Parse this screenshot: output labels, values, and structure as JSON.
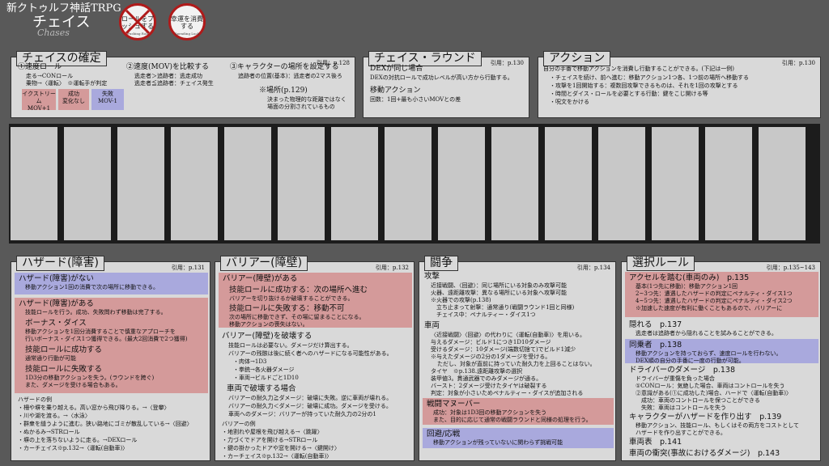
{
  "header": {
    "title": "新クトゥルフ神話TRPG",
    "subtitle": "チェイス",
    "subtitle_en": "Chases",
    "badge1": {
      "text": "ロールをプッシュする",
      "sub": "Pushing Roll"
    },
    "badge2": {
      "text": "幸運を消費する",
      "sub": "Spending Luck"
    }
  },
  "confirm": {
    "title": "チェイスの確定",
    "ref": "引用：p.128",
    "s1": {
      "title": "①速度ロール",
      "l1": "走る→CONロール",
      "l2": "乗物→〈運転〉　※運転手が判定"
    },
    "chips": [
      {
        "label": "イクストリーム",
        "value": "MOV+1",
        "color": "#d49a9a"
      },
      {
        "label": "成功",
        "value": "変化なし",
        "color": "#d49a9a"
      },
      {
        "label": "失敗",
        "value": "MOV-1",
        "color": "#a9a9dd"
      }
    ],
    "s2": {
      "title": "②速度(MOV)を比較する",
      "l1": "逃走者＞追跡者：逃走成功",
      "l2": "逃走者≦追跡者：チェイス発生"
    },
    "s3": {
      "title": "③キャラクターの場所を設定する",
      "l1": "追跡者の位置(基本)：逃走者の2マス後ろ"
    },
    "place": {
      "title": "※場所(p.129)",
      "l1": "決まった物理的な距離ではなく",
      "l2": "場面の分割されているもの"
    }
  },
  "round": {
    "title": "チェイス・ラウンド",
    "ref": "引用：p.130",
    "h1": "DEXが同じ場合",
    "t1": "DEXの対抗ロールで成功レベルが高い方から行動する。",
    "h2": "移動アクション",
    "t2": "回数：1回+最も小さいMOVとの差"
  },
  "action": {
    "title": "アクション",
    "ref": "引用：p.130",
    "intro": "自分の手番で移動アクションを消費し行動することができる。(下記は一例)",
    "items": [
      "・チェイスを続け、前へ進む：移動アクション1つ各、1つ前の場所へ移動する",
      "・攻撃を1回開始する：複数回攻撃できるものは、それを1回の攻撃とする",
      "・時間とダイス・ロールを必要とする行動：鍵をこじ開ける等",
      "・呪文をかける"
    ]
  },
  "hazard": {
    "title": "ハザード(障害)",
    "ref": "引用：p.131",
    "none": {
      "title": "ハザード(障害)がない",
      "text": "移動アクション1回の消費で次の場所に移動できる。"
    },
    "exists": {
      "title": "ハザード(障害)がある",
      "text": "技能ロールを行う。成功、失敗問わず移動は完了する。",
      "bonus_title": "ボーナス・ダイス",
      "bonus_l1": "移動アクションを1回分消費することで慎重なアプローチを",
      "bonus_l2": "行いボーナス・ダイス1つ獲得できる。(最大2回消費で2つ獲得)",
      "succ_title": "技能ロールに成功する",
      "succ_text": "通常通り行動が可能",
      "fail_title": "技能ロールに失敗する",
      "fail_l1": "1D3分の移動アクションを失う。(ラウンドを跨ぐ)",
      "fail_l2": "また、ダメージを受ける場合もある。"
    },
    "ex_title": "ハザードの例",
    "examples": [
      "・柵や塀を乗り越える。高い窓から飛び降りる。→〈登攀〉",
      "・川や湖を渡る。→〈水泳〉",
      "・群衆を縫うように進む。狭い路地にゴミが散乱している→〈回避〉",
      "・ぬかるみ→STRロール",
      "・塀の上を落ちないように走る。→DEXロール",
      "・カーチェイス※p.132→〈運転(自動車)〉"
    ]
  },
  "barrier": {
    "title": "バリアー(障壁)",
    "ref": "引用：p.132",
    "box": {
      "title": "バリアー(障壁)がある",
      "succ_title": "技能ロールに成功する：次の場所へ進む",
      "succ_text": "バリアーを切り抜けるか破壊することができる。",
      "fail_title": "技能ロールに失敗する：移動不可",
      "fail_l1": "次の場所に移動できず、その場に留まることになる。",
      "fail_l2": "移動アクションの喪失はない。"
    },
    "destroy": {
      "title": "バリアー(障壁)を破壊する",
      "l1": "技能ロールは必要ない。ダメージだけ算出する。",
      "l2": "バリアーの残骸は後に続く者へのハザードになる可能性がある。",
      "items": [
        "・肉体→1D3",
        "・拳銃→各火器ダメージ",
        "・車両→ビルドごと1D10"
      ]
    },
    "vehicle": {
      "title": "車両で破壊する場合",
      "l1": "バリアーの耐久力≧ダメージ：破壊に失敗。逆に車両が壊れる。",
      "l2": "バリアーの耐久力＜ダメージ：破壊に成功。ダメージを受ける。",
      "l3": "車両へのダメージ：バリアーが持っていた耐久力の2分の1"
    },
    "ex_title": "バリアーの例",
    "examples": [
      "・地割れや屋根を飛び越える→〈跳躍〉",
      "・力づくでドアを開ける→STRロール",
      "・鍵の掛かったドアや窓を開ける→〈鍵開け〉",
      "・カーチェイス※p.132→〈運転(自動車)〉"
    ]
  },
  "fight": {
    "title": "闘争",
    "ref": "引用：p.134",
    "attack": {
      "title": "攻撃",
      "items": [
        "近接戦闘、〈回避〉：同じ場所にいる対象のみ攻撃可能",
        "火器、遠距離攻撃：異なる場所にいる対象へ攻撃可能",
        "※火器での攻撃(p.138)",
        "　立ち止まって射撃：通常通り(戦闘ラウンド1回と同様)",
        "　チェイス中：ペナルティー・ダイス1つ"
      ]
    },
    "vehicle": {
      "title": "車両",
      "items": [
        "〈近接戦闘〉〈回避〉の代わりに〈運転(自動車)〉を用いる。",
        "与えるダメージ：ビルド1につき1D10ダメージ",
        "受けるダメージ：10ダメージ(端数切捨て)でビルド1減少",
        "※与えたダメージの2分の1ダメージを受ける。",
        "ただし、対象が直前に持っていた耐久力を上回ることはない。",
        "タイヤ　※p.138.遠距離攻撃の選択",
        "装甲値3。貫通武器でのみダメージが通る。",
        "バースト：2ダメージ受けたタイヤは破裂する",
        "判定：対象が小さいためペナルティー・ダイスが追加される"
      ]
    },
    "maneuver": {
      "title": "戦闘マヌーバー",
      "l1": "成功：対象は1D3回の移動アクションを失う",
      "l2": "また、目的に応じて通常の戦闘ラウンドと同様の処理を行う。"
    },
    "react": {
      "title": "回避/応戦",
      "text": "移動アクションが残っていないに関わらず挑戦可能"
    }
  },
  "options": {
    "title": "選択ルール",
    "ref": "引用：p.135~143",
    "accel": {
      "title": "アクセルを踏む(車両のみ)　p.135",
      "items": [
        "基本(1つ先に移動)：移動アクション1回",
        "2~3つ先：遭遇したハザードの判定にペナルティ・ダイス1つ",
        "4~5つ先：遭遇したハザードの判定にペナルティ・ダイス2つ",
        "※加速した速度が有利に働くこともあるので、バリアーに",
        "　ペナルティ・ダイスは普通適用されない。"
      ]
    },
    "hide": {
      "title": "隠れる　p.137",
      "text": "逃走者は追跡者から隠れることを試みることができる。"
    },
    "passenger": {
      "title": "同乗者　p.138",
      "l1": "移動アクションを持っておらず、速度ロールを行わない。",
      "l2": "DEX順の自分の手番に一度の行動が可能。"
    },
    "driver": {
      "title": "ドライバーのダメージ　p.138",
      "items": [
        "ドライバーが重傷を負った場合",
        "①CONロール：気絶した場合、車両はコントロールを失う",
        "②意識がある(①に成功した)場合、ハードで〈運転(自動車)〉",
        "　成功：車両のコントロールを保つことができる",
        "　失敗：車両はコントロールを失う"
      ]
    },
    "build": {
      "title": "キャラクターがハザードを作り出す　p.139",
      "l1": "移動アクション、技能ロール、もしくはその両方をコストとして",
      "l2": "ハザードを作り出すことができる。"
    },
    "table": {
      "title": "車両表　p.141"
    },
    "crash": {
      "title": "車両の衝突(事故におけるダメージ)　p.143"
    }
  }
}
